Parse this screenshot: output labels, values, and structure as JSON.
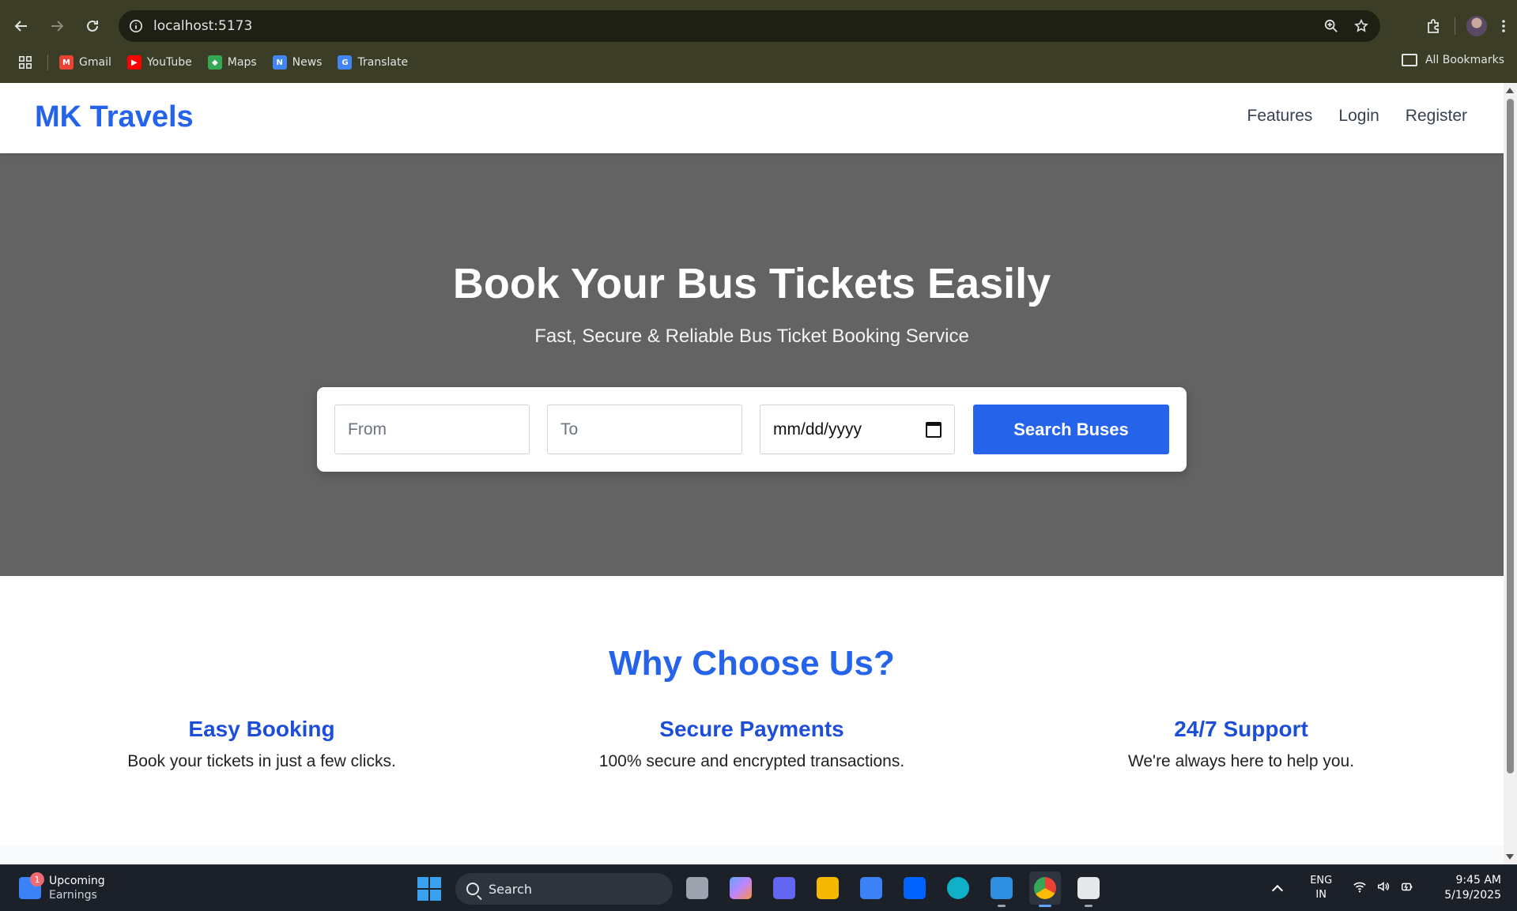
{
  "browser": {
    "url": "localhost:5173",
    "bookmarks": [
      {
        "label": "Gmail",
        "icon": "gmail-icon",
        "color": "#ea4335"
      },
      {
        "label": "YouTube",
        "icon": "youtube-icon",
        "color": "#ff0000"
      },
      {
        "label": "Maps",
        "icon": "maps-icon",
        "color": "#34a853"
      },
      {
        "label": "News",
        "icon": "news-icon",
        "color": "#4285f4"
      },
      {
        "label": "Translate",
        "icon": "translate-icon",
        "color": "#4285f4"
      }
    ],
    "all_bookmarks_label": "All Bookmarks"
  },
  "site": {
    "brand": "MK Travels",
    "brand_color": "#2563eb",
    "nav": [
      "Features",
      "Login",
      "Register"
    ]
  },
  "hero": {
    "title": "Book Your Bus Tickets Easily",
    "subtitle": "Fast, Secure & Reliable Bus Ticket Booking Service",
    "from_placeholder": "From",
    "to_placeholder": "To",
    "date_placeholder": "mm/dd/yyyy",
    "search_button": "Search Buses"
  },
  "features": {
    "title": "Why Choose Us?",
    "items": [
      {
        "title": "Easy Booking",
        "text": "Book your tickets in just a few clicks."
      },
      {
        "title": "Secure Payments",
        "text": "100% secure and encrypted transactions."
      },
      {
        "title": "24/7 Support",
        "text": "We're always here to help you."
      }
    ]
  },
  "taskbar": {
    "widget_badge": "1",
    "widget_title": "Upcoming",
    "widget_sub": "Earnings",
    "search_label": "Search",
    "apps": [
      {
        "name": "task-view-icon",
        "color": "#9ca3af"
      },
      {
        "name": "copilot-icon",
        "color": "#c084fc"
      },
      {
        "name": "teams-icon",
        "color": "#6366f1"
      },
      {
        "name": "file-explorer-icon",
        "color": "#f5b800"
      },
      {
        "name": "microsoft-store-icon",
        "color": "#3b82f6"
      },
      {
        "name": "dropbox-icon",
        "color": "#0061fe"
      },
      {
        "name": "edge-icon",
        "color": "#10b0c8"
      },
      {
        "name": "vscode-icon",
        "color": "#2f8fe0"
      },
      {
        "name": "chrome-icon",
        "color": "#ea4335"
      },
      {
        "name": "snipping-tool-icon",
        "color": "#e5e7eb"
      }
    ],
    "lang_top": "ENG",
    "lang_bottom": "IN",
    "time": "9:45 AM",
    "date": "5/19/2025"
  }
}
